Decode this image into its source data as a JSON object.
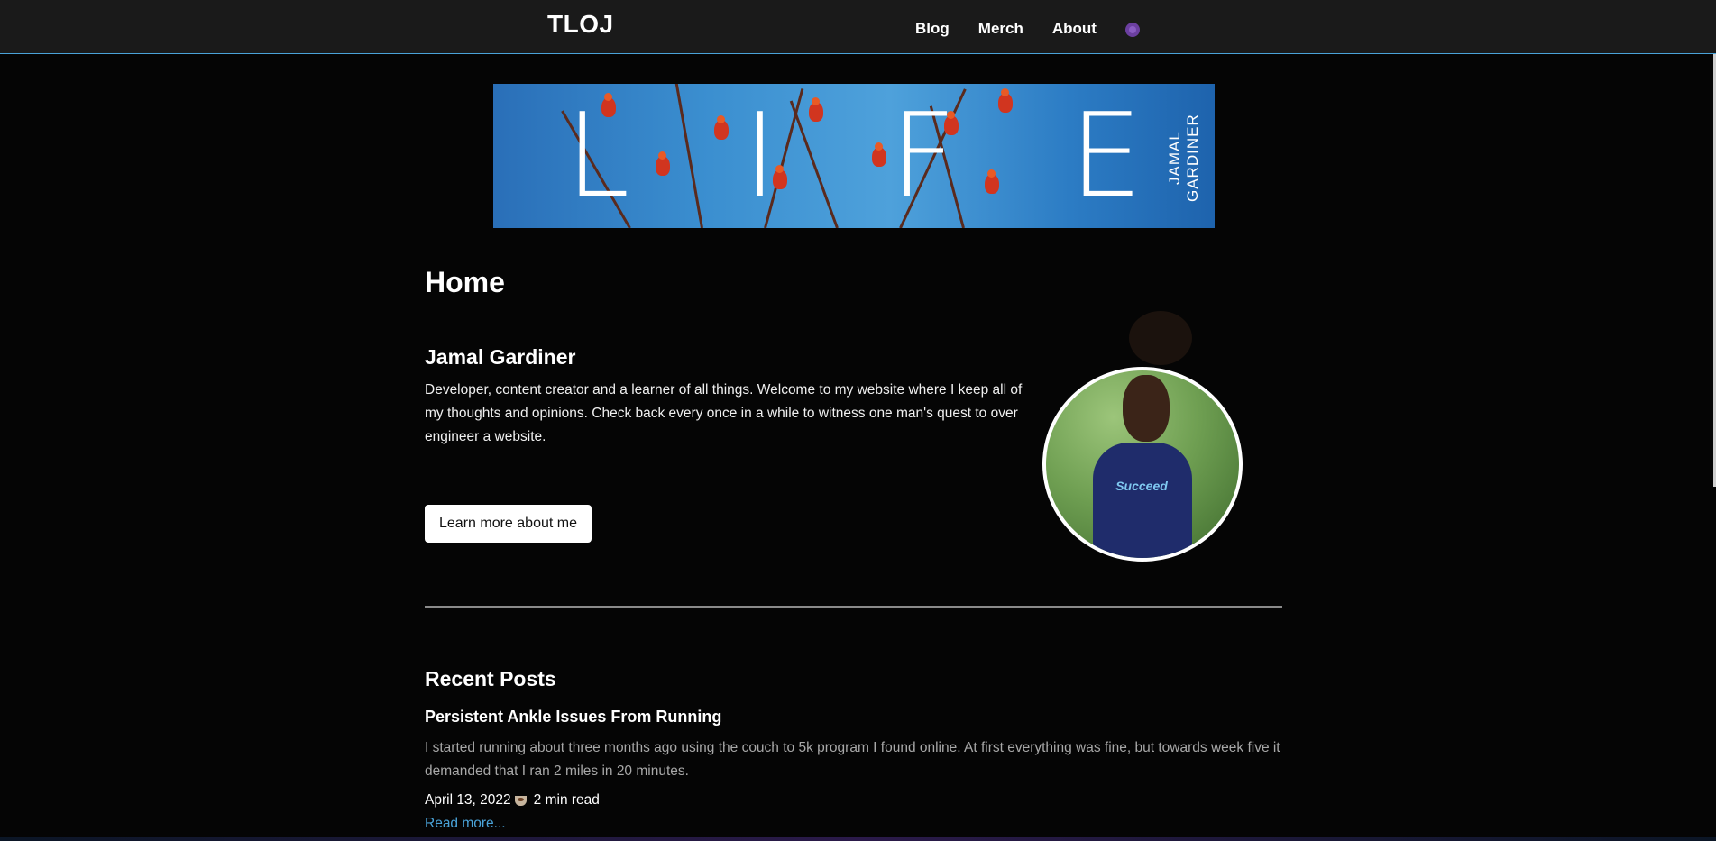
{
  "header": {
    "logo": "TLOJ",
    "nav": [
      "Blog",
      "Merch",
      "About"
    ],
    "theme_icon": "theme-toggle-icon"
  },
  "banner": {
    "letters": [
      "L",
      "I",
      "F",
      "E"
    ],
    "side_text": "JAMAL GARDINER"
  },
  "main": {
    "page_title": "Home",
    "author_name": "Jamal Gardiner",
    "bio": "Developer, content creator and a learner of all things. Welcome to my website where I keep all of my thoughts and opinions. Check back every once in a while to witness one man's quest to over engineer a website.",
    "learn_button": "Learn more about me",
    "avatar_shirt_text": "Succeed"
  },
  "recent_posts": {
    "heading": "Recent Posts",
    "posts": [
      {
        "title": "Persistent Ankle Issues From Running",
        "excerpt": "I started running about three months ago using the couch to 5k program I found online. At first everything was fine, but towards week five it demanded that I ran 2 miles in 20 minutes.",
        "date": "April 13, 2022",
        "read_time": "2 min read",
        "read_more": "Read more..."
      }
    ]
  },
  "colors": {
    "background": "#050505",
    "header": "#1a1a1a",
    "accent": "#4aa3d9"
  }
}
